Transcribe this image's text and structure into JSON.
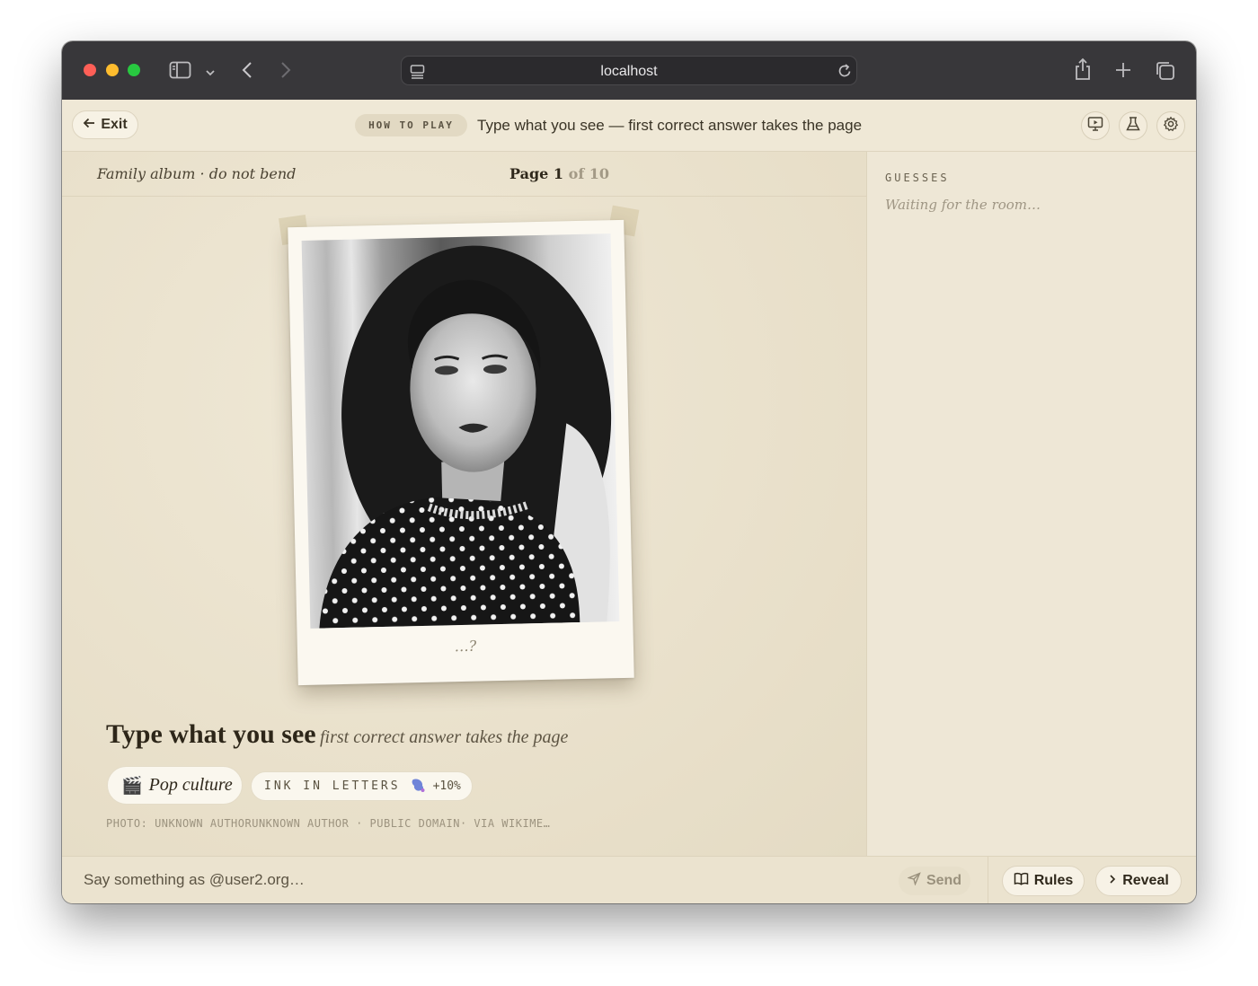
{
  "browser": {
    "url": "localhost",
    "icons": [
      "sidebar-icon",
      "chevron-down-icon",
      "back-icon",
      "forward-icon",
      "site-settings-icon",
      "reload-icon",
      "share-icon",
      "new-tab-icon",
      "tabs-overview-icon"
    ]
  },
  "header": {
    "exit_label": "Exit",
    "how_to_play": "HOW TO PLAY",
    "subtitle": "Type what you see — first correct answer takes the page",
    "icons": [
      "presentation-icon",
      "flask-icon",
      "gear-icon"
    ]
  },
  "album": {
    "label": "Family album · do not bend",
    "page_prefix": "Page",
    "page_current": "1",
    "page_of": "of 10"
  },
  "photo": {
    "caption": "…?"
  },
  "prompt": {
    "title": "Type what you see",
    "subtitle": "first correct answer takes the page",
    "category_icon": "🎬",
    "category": "Pop culture",
    "bonus_label": "INK IN LETTERS",
    "bonus_icon": "ink-blob-icon",
    "bonus_value": "+10%",
    "credit": "PHOTO: UNKNOWN AUTHORUNKNOWN AUTHOR · PUBLIC DOMAIN· VIA WIKIME…"
  },
  "guesses": {
    "label": "GUESSES",
    "empty_text": "Waiting for the room…"
  },
  "footer": {
    "chat_placeholder": "Say something as @user2.org…",
    "send_label": "Send",
    "rules_label": "Rules",
    "reveal_label": "Reveal"
  },
  "colors": {
    "paper": "#ece4d0",
    "chrome": "#38373a",
    "ink": "#2d2619"
  }
}
